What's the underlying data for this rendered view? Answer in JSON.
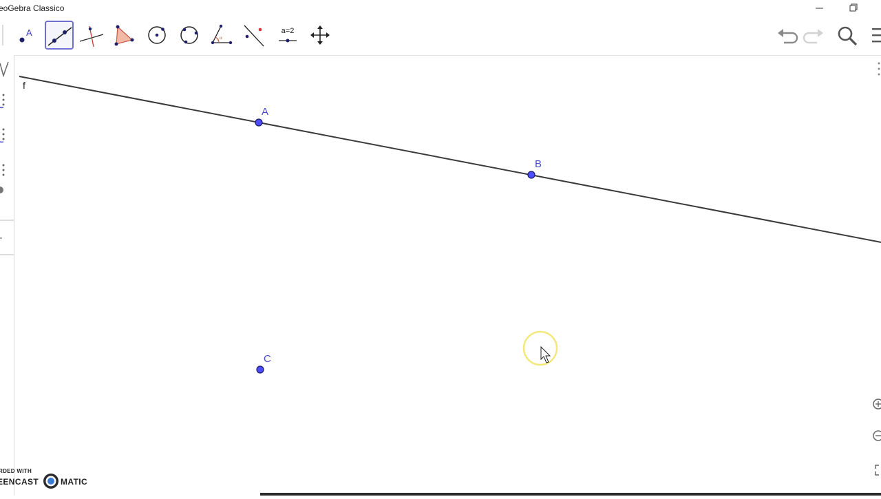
{
  "window": {
    "title": "eoGebra Classico"
  },
  "toolbar": {
    "tools": [
      {
        "name": "point-tool",
        "icon": "point-icon"
      },
      {
        "name": "line-tool",
        "icon": "line-icon",
        "selected": true
      },
      {
        "name": "perpendicular-line-tool",
        "icon": "perpendicular-icon"
      },
      {
        "name": "polygon-tool",
        "icon": "polygon-icon"
      },
      {
        "name": "circle-center-point-tool",
        "icon": "circle-center-icon"
      },
      {
        "name": "circle-three-points-tool",
        "icon": "circle-three-points-icon"
      },
      {
        "name": "angle-tool",
        "icon": "angle-icon"
      },
      {
        "name": "reflect-tool",
        "icon": "reflect-icon"
      },
      {
        "name": "slider-tool",
        "icon": "slider-icon",
        "text": "a=2"
      },
      {
        "name": "move-graphics-view-tool",
        "icon": "move-arrows-icon"
      }
    ],
    "right_icons": [
      "undo-icon",
      "redo-icon",
      "search-icon",
      "menu-icon"
    ]
  },
  "construction": {
    "line_label": "f",
    "points": [
      {
        "label": "A"
      },
      {
        "label": "B"
      },
      {
        "label": "C"
      }
    ],
    "colors": {
      "point_fill": "#4d4dff",
      "point_stroke": "#1a1a66",
      "line": "#3a3a3a",
      "label": "#4b4bc8",
      "cursor_highlight": "#f2e66b"
    }
  },
  "watermark": {
    "line1": "RDED WITH",
    "line2a": "EENCAST",
    "line2b": "MATIC"
  }
}
